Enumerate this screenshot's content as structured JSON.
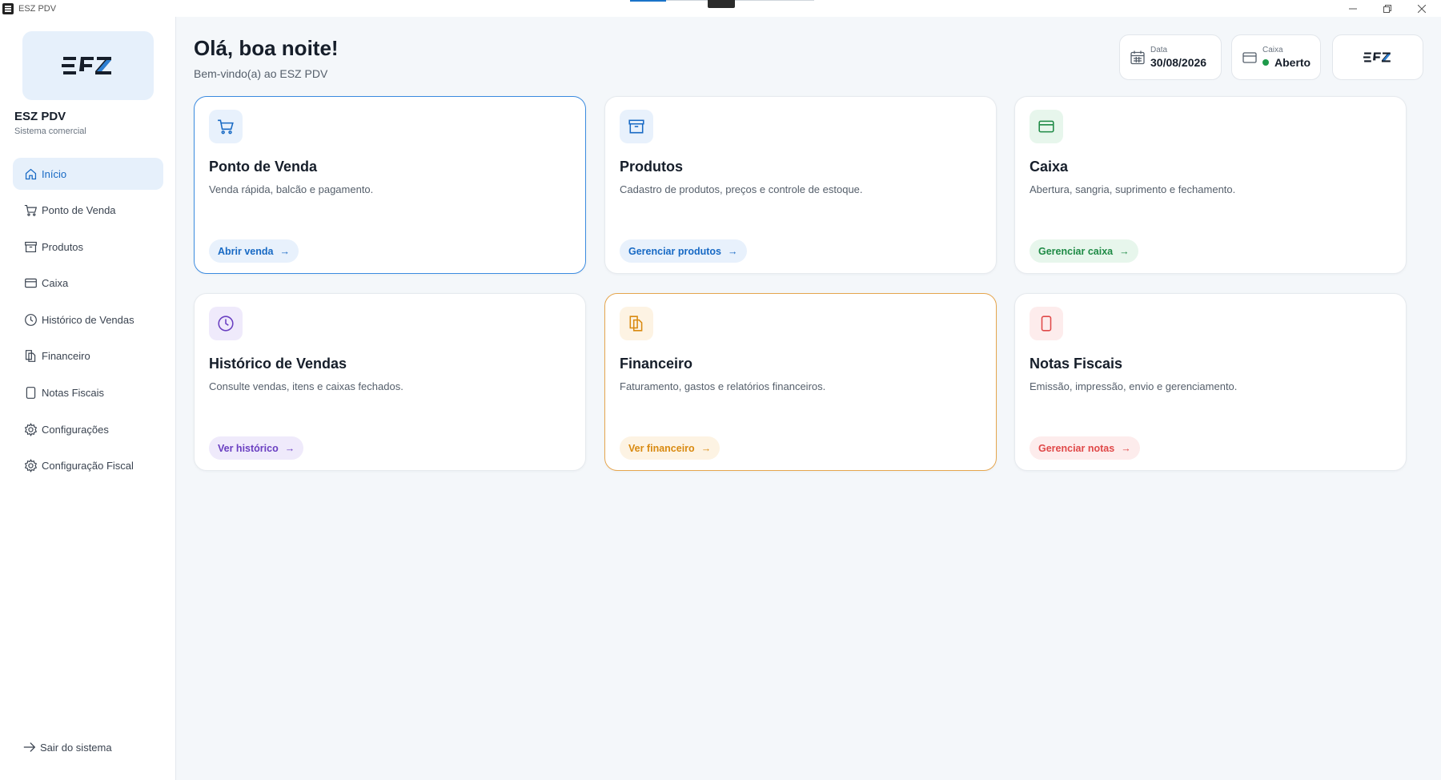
{
  "window": {
    "title": "ESZ PDV",
    "controls": [
      "minimize",
      "restore",
      "close"
    ]
  },
  "sidebar": {
    "logo_text": "ESZ",
    "brand_title": "ESZ PDV",
    "brand_subtitle": "Sistema comercial",
    "items": [
      {
        "label": "Início",
        "icon": "home-icon",
        "active": true
      },
      {
        "label": "Ponto de Venda",
        "icon": "cart-icon"
      },
      {
        "label": "Produtos",
        "icon": "box-icon"
      },
      {
        "label": "Caixa",
        "icon": "card-icon"
      },
      {
        "label": "Histórico de Vendas",
        "icon": "clock-icon"
      },
      {
        "label": "Financeiro",
        "icon": "documents-icon"
      },
      {
        "label": "Notas Fiscais",
        "icon": "receipt-icon"
      },
      {
        "label": "Configurações",
        "icon": "gear-icon"
      },
      {
        "label": "Configuração Fiscal",
        "icon": "gear-icon"
      }
    ],
    "logout_label": "Sair do sistema"
  },
  "header": {
    "greeting": "Olá, boa noite!",
    "welcome": "Bem-vindo(a) ao ESZ PDV",
    "date_label": "Data",
    "date_value": "30/08/2026",
    "cashier_label": "Caixa",
    "cashier_status": "Aberto",
    "status_color": "#1e9a4a",
    "logo_text": "ESZ"
  },
  "cards": [
    {
      "title": "Ponto de Venda",
      "description": "Venda rápida, balcão e pagamento.",
      "button": "Abrir venda",
      "arrow": "→",
      "icon": "cart-icon",
      "accent": "#1769c4",
      "tint": "#e8f1fc"
    },
    {
      "title": "Produtos",
      "description": "Cadastro de produtos, preços e controle de estoque.",
      "button": "Gerenciar produtos",
      "arrow": "→",
      "icon": "box-icon",
      "accent": "#1769c4",
      "tint": "#e8f1fc"
    },
    {
      "title": "Caixa",
      "description": "Abertura, sangria, suprimento e fechamento.",
      "button": "Gerenciar caixa",
      "arrow": "→",
      "icon": "card-icon",
      "accent": "#1e8a45",
      "tint": "#e7f6ec"
    },
    {
      "title": "Histórico de Vendas",
      "description": "Consulte vendas, itens e caixas fechados.",
      "button": "Ver histórico",
      "arrow": "→",
      "icon": "clock-icon",
      "accent": "#6a3fc1",
      "tint": "#efeafb"
    },
    {
      "title": "Financeiro",
      "description": "Faturamento, gastos e relatórios financeiros.",
      "button": "Ver financeiro",
      "arrow": "→",
      "icon": "documents-icon",
      "accent": "#d98a10",
      "tint": "#fdf3e3"
    },
    {
      "title": "Notas Fiscais",
      "description": "Emissão, impressão, envio e gerenciamento.",
      "button": "Gerenciar notas",
      "arrow": "→",
      "icon": "receipt-icon",
      "accent": "#e04848",
      "tint": "#fdecec"
    }
  ]
}
